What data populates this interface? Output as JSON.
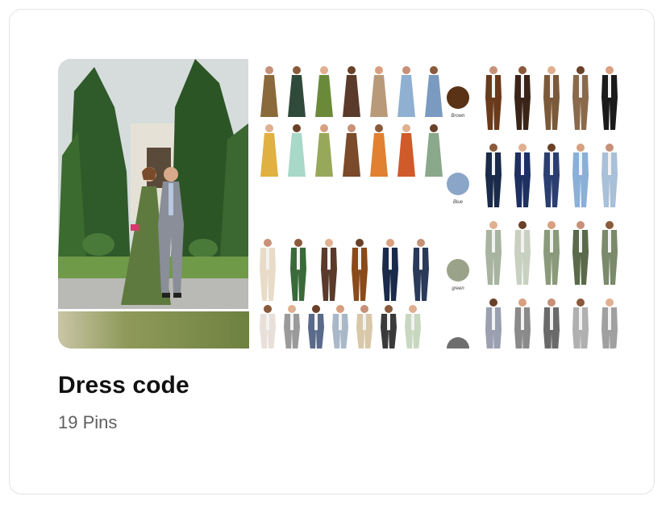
{
  "board": {
    "title": "Dress code",
    "pin_count": "19 Pins"
  },
  "collage": {
    "main_image": "couple-at-wedding-photo",
    "strip_image": "olive-gown-fabric-photo",
    "right_image": "dress-code-guest-outfits-photo"
  },
  "swatches": [
    {
      "label": "Brown",
      "color": "#5a3316"
    },
    {
      "label": "Blue",
      "color": "#8aa5c7"
    },
    {
      "label": "green",
      "color": "#9aa38a"
    }
  ],
  "colors": {
    "card_border": "#e3e3e3",
    "title": "#111111",
    "subtitle": "#5f5f5f"
  }
}
